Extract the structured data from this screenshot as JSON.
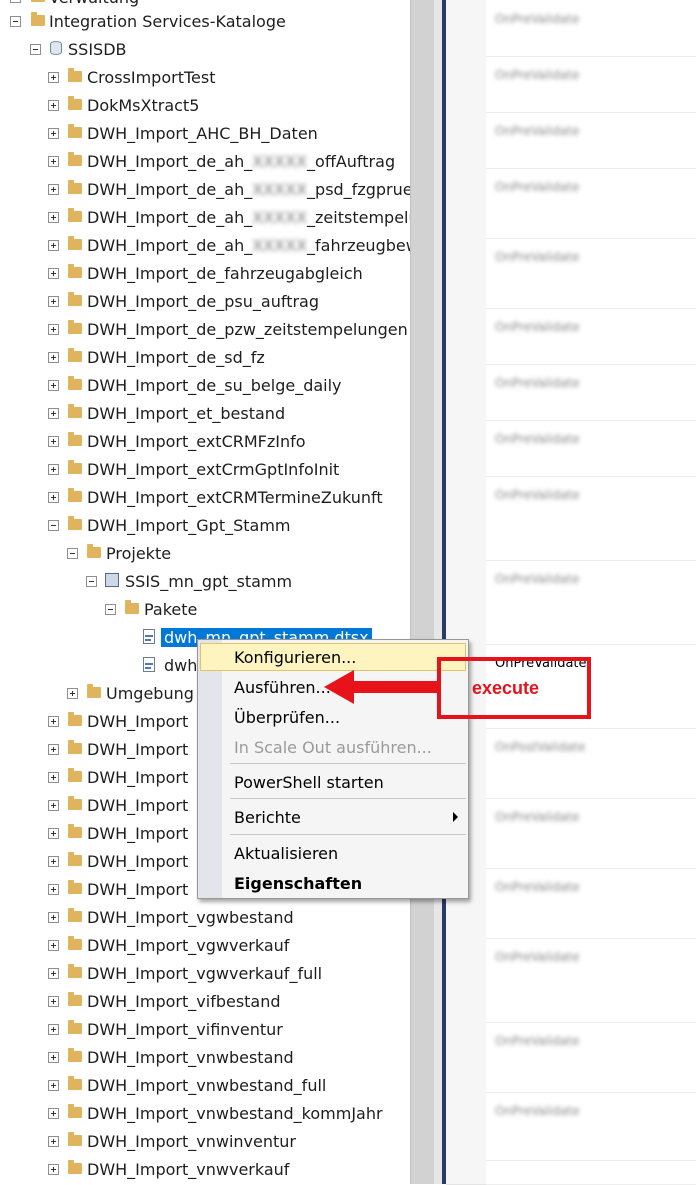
{
  "tree": {
    "top_partial": "Verwaltung",
    "catalog_label": "Integration Services-Kataloge",
    "db_label": "SSISDB",
    "folders": [
      {
        "label": "CrossImportTest"
      },
      {
        "label": "DokMsXtract5"
      },
      {
        "label": "DWH_Import_AHC_BH_Daten"
      },
      {
        "label": "DWH_Import_de_ah_",
        "blur": "XXXXX",
        "suffix": "_offAuftrag"
      },
      {
        "label": "DWH_Import_de_ah_",
        "blur": "XXXXX",
        "suffix": "_psd_fzgpruef"
      },
      {
        "label": "DWH_Import_de_ah_",
        "blur": "XXXXX",
        "suffix": "_zeitstempelu"
      },
      {
        "label": "DWH_Import_de_ah_",
        "blur": "XXXXX",
        "suffix": "_fahrzeugbew"
      },
      {
        "label": "DWH_Import_de_fahrzeugabgleich"
      },
      {
        "label": "DWH_Import_de_psu_auftrag"
      },
      {
        "label": "DWH_Import_de_pzw_zeitstempelungen"
      },
      {
        "label": "DWH_Import_de_sd_fz"
      },
      {
        "label": "DWH_Import_de_su_belge_daily"
      },
      {
        "label": "DWH_Import_et_bestand"
      },
      {
        "label": "DWH_Import_extCRMFzInfo"
      },
      {
        "label": "DWH_Import_extCrmGptInfoInit"
      },
      {
        "label": "DWH_Import_extCRMTermineZukunft"
      }
    ],
    "expanded_folder": "DWH_Import_Gpt_Stamm",
    "projects_label": "Projekte",
    "project_label": "SSIS_mn_gpt_stamm",
    "packages_label": "Pakete",
    "package_selected": "dwh_mn_gpt_stamm.dtsx",
    "package_second": "dwh",
    "environments_label": "Umgebung",
    "hidden_folders": [
      "DWH_Import",
      "DWH_Import",
      "DWH_Import",
      "DWH_Import",
      "DWH_Import",
      "DWH_Import",
      "DWH_Import"
    ],
    "bottom_folders": [
      "DWH_Import_vgwbestand",
      "DWH_Import_vgwverkauf",
      "DWH_Import_vgwverkauf_full",
      "DWH_Import_vifbestand",
      "DWH_Import_vifinventur",
      "DWH_Import_vnwbestand",
      "DWH_Import_vnwbestand_full",
      "DWH_Import_vnwbestand_kommJahr",
      "DWH_Import_vnwinventur",
      "DWH_Import_vnwverkauf"
    ]
  },
  "context_menu": {
    "configure": "Konfigurieren...",
    "execute": "Ausführen...",
    "validate": "Überprüfen...",
    "scaleout": "In Scale Out ausführen...",
    "powershell": "PowerShell starten",
    "reports": "Berichte",
    "refresh": "Aktualisieren",
    "properties": "Eigenschaften"
  },
  "right_pane": {
    "visible_event": "OnPreValidate",
    "blurred_events": [
      "OnPreValidate",
      "OnPreValidate",
      "OnPreValidate",
      "OnPreValidate",
      "OnPreValidate",
      "OnPreValidate",
      "OnPreValidate",
      "OnPreValidate",
      "OnPreValidate",
      "OnPreValidate",
      "OnPostValidate",
      "OnPreValidate",
      "OnPreValidate",
      "OnPreValidate",
      "OnPreValidate",
      "OnPreValidate",
      "OnPreValidate"
    ]
  },
  "annotation": {
    "label": "execute",
    "color": "#e8121a"
  }
}
